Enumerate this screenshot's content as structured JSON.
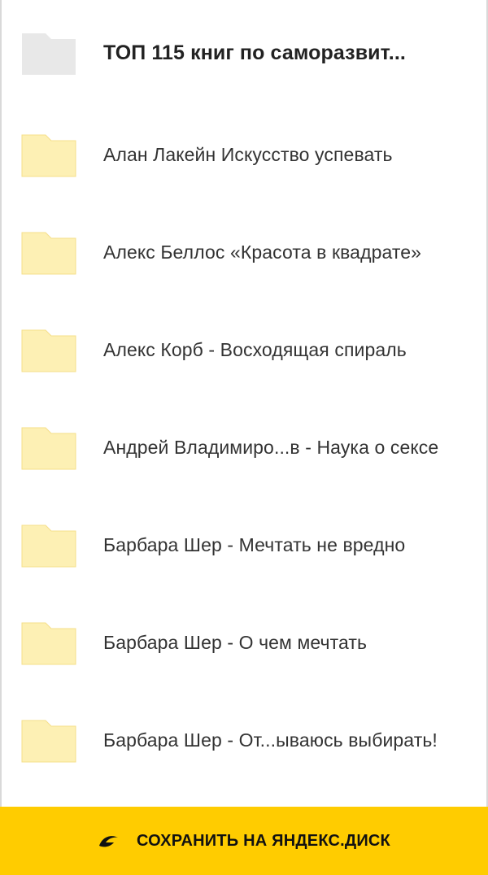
{
  "folders": [
    {
      "label": "ТОП 115 книг по саморазвит...",
      "icon": "folder-icon",
      "color": "#e8e8e8",
      "title": true
    },
    {
      "label": "Алан Лакейн Искусство успевать",
      "icon": "folder-icon",
      "color": "#fdf0b4"
    },
    {
      "label": "Алекс Беллос «Красота в квадрате»",
      "icon": "folder-icon",
      "color": "#fdf0b4"
    },
    {
      "label": "Алекс Корб - Восходящая спираль",
      "icon": "folder-icon",
      "color": "#fdf0b4"
    },
    {
      "label": "Андрей Владимиро...в - Наука о сексе",
      "icon": "folder-icon",
      "color": "#fdf0b4"
    },
    {
      "label": "Барбара Шер - Мечтать не вредно",
      "icon": "folder-icon",
      "color": "#fdf0b4"
    },
    {
      "label": "Барбара Шер - О чем мечтать",
      "icon": "folder-icon",
      "color": "#fdf0b4"
    },
    {
      "label": "Барбара Шер - От...ываюсь выбирать!",
      "icon": "folder-icon",
      "color": "#fdf0b4"
    }
  ],
  "save_bar": {
    "label": "СОХРАНИТЬ НА ЯНДЕКС.ДИСК",
    "icon": "yandex-disk-icon",
    "background": "#ffcc00"
  }
}
